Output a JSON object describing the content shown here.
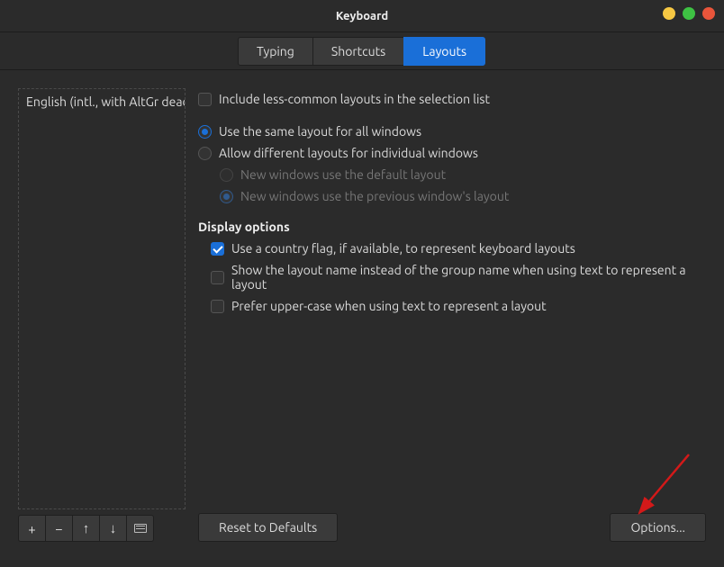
{
  "window": {
    "title": "Keyboard"
  },
  "tabs": {
    "typing": "Typing",
    "shortcuts": "Shortcuts",
    "layouts": "Layouts"
  },
  "layouts_list": {
    "item0": "English (intl., with AltGr dead keys)"
  },
  "options": {
    "include_less_common": "Include less-common layouts in the selection list",
    "same_layout_all": "Use the same layout for all windows",
    "allow_different": "Allow different layouts for individual windows",
    "new_windows_default": "New windows use the default layout",
    "new_windows_previous": "New windows use the previous window's layout",
    "display_section": "Display options",
    "use_flag": "Use a country flag, if available,  to represent keyboard layouts",
    "show_layout_name": "Show the layout name instead of the group name when using text to represent a layout",
    "prefer_upper": "Prefer upper-case when using text to represent a layout"
  },
  "buttons": {
    "reset": "Reset to Defaults",
    "options": "Options..."
  },
  "icons": {
    "add": "+",
    "remove": "−",
    "up": "↑",
    "down": "↓"
  }
}
